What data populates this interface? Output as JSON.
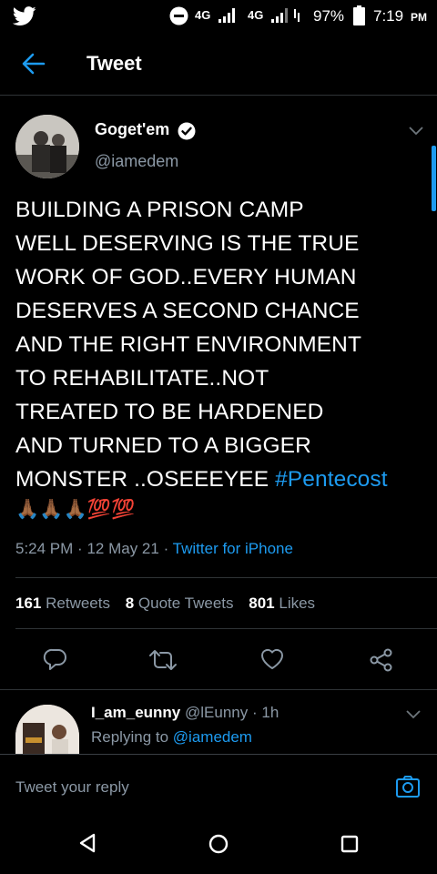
{
  "status_bar": {
    "network1": "4G",
    "network2": "4G",
    "battery": "97%",
    "time": "7:19",
    "ampm": "PM"
  },
  "header": {
    "title": "Tweet"
  },
  "tweet": {
    "display_name": "Goget'em",
    "handle": "@iamedem",
    "lines": [
      "BUILDING A PRISON CAMP",
      "WELL DESERVING IS THE TRUE",
      "WORK OF GOD..EVERY HUMAN",
      "DESERVES A SECOND CHANCE",
      "AND THE RIGHT ENVIRONMENT",
      "TO REHABILITATE..NOT",
      "TREATED TO BE  HARDENED",
      "AND TURNED TO A BIGGER"
    ],
    "last_line": "MONSTER ..OSEEEYEE ",
    "hashtag": "#Pentecost",
    "emoji_line": "🙏🏾🙏🏾🙏🏾💯💯",
    "time": "5:24 PM",
    "date": "12 May 21",
    "source": "Twitter for iPhone",
    "retweets_count": "161",
    "retweets_label": "Retweets",
    "quote_count": "8",
    "quote_label": "Quote Tweets",
    "likes_count": "801",
    "likes_label": "Likes"
  },
  "reply": {
    "display_name": "I_am_eunny",
    "handle": "@lEunny",
    "time": "1h",
    "replying_prefix": "Replying to",
    "replying_to": "@iamedem"
  },
  "compose": {
    "placeholder": "Tweet your reply"
  },
  "colors": {
    "accent": "#1d9bf0",
    "muted": "#8b98a5",
    "divider": "#2f3336"
  }
}
